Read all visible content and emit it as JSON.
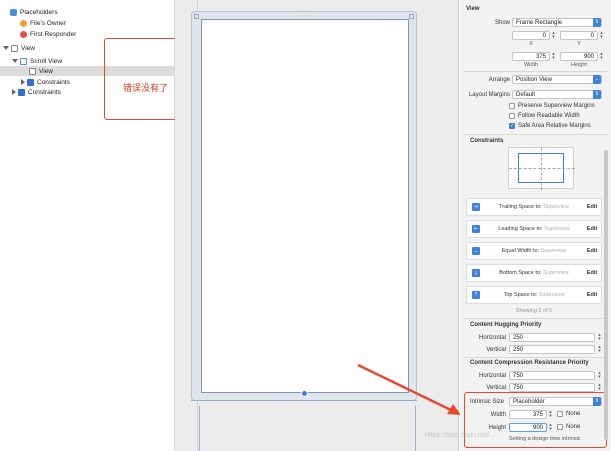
{
  "outline": {
    "items": [
      {
        "label": "Placeholders",
        "icon": "cube-icon"
      },
      {
        "label": "File's Owner",
        "icon": "owner-icon"
      },
      {
        "label": "First Responder",
        "icon": "responder-icon"
      },
      {
        "label": "View",
        "icon": "view-icon"
      },
      {
        "label": "Scroll View",
        "icon": "scroll-view-icon"
      },
      {
        "label": "View",
        "icon": "view-icon"
      },
      {
        "label": "Constraints",
        "icon": "constraints-icon"
      },
      {
        "label": "Constraints",
        "icon": "constraints-icon"
      }
    ],
    "note": "错误没有了"
  },
  "inspector": {
    "view_section": "View",
    "show_label": "Show",
    "show_value": "Frame Rectangle",
    "x_value": "0",
    "y_value": "0",
    "x_label": "X",
    "y_label": "Y",
    "width_value": "375",
    "height_value": "900",
    "width_label": "Width",
    "height_label": "Height",
    "arrange_label": "Arrange",
    "arrange_value": "Position View",
    "layout_margins_label": "Layout Margins",
    "layout_margins_value": "Default",
    "preserve_superview": "Preserve Superview Margins",
    "follow_readable": "Follow Readable Width",
    "safe_area": "Safe Area Relative Margins",
    "constraints_section": "Constraints",
    "constraints": [
      {
        "name": "Trailing Space to:",
        "target": "Superview",
        "edit": "Edit"
      },
      {
        "name": "Leading Space to:",
        "target": "Superview",
        "edit": "Edit"
      },
      {
        "name": "Equal Width to:",
        "target": "Superview",
        "edit": "Edit"
      },
      {
        "name": "Bottom Space to:",
        "target": "Superview",
        "edit": "Edit"
      },
      {
        "name": "Top Space to:",
        "target": "Superview",
        "edit": "Edit"
      }
    ],
    "showing": "Showing 5 of 5",
    "hugging_section": "Content Hugging Priority",
    "hugging_horizontal_label": "Horizontal",
    "hugging_horizontal": "250",
    "hugging_vertical_label": "Vertical",
    "hugging_vertical": "250",
    "compression_section": "Content Compression Resistance Priority",
    "compression_horizontal_label": "Horizontal",
    "compression_horizontal": "750",
    "compression_vertical_label": "Vertical",
    "compression_vertical": "750",
    "intrinsic_label": "Intrinsic Size",
    "intrinsic_value": "Placeholder",
    "intrinsic_width_label": "Width",
    "intrinsic_width": "375",
    "intrinsic_height_label": "Height",
    "intrinsic_height": "900",
    "none_label": "None",
    "footer_text": "Setting a design time intrinsic"
  },
  "watermark": "https://blog.csdn.net/...",
  "colors": {
    "accent": "#3d82e0",
    "annotation": "#e8492e"
  }
}
